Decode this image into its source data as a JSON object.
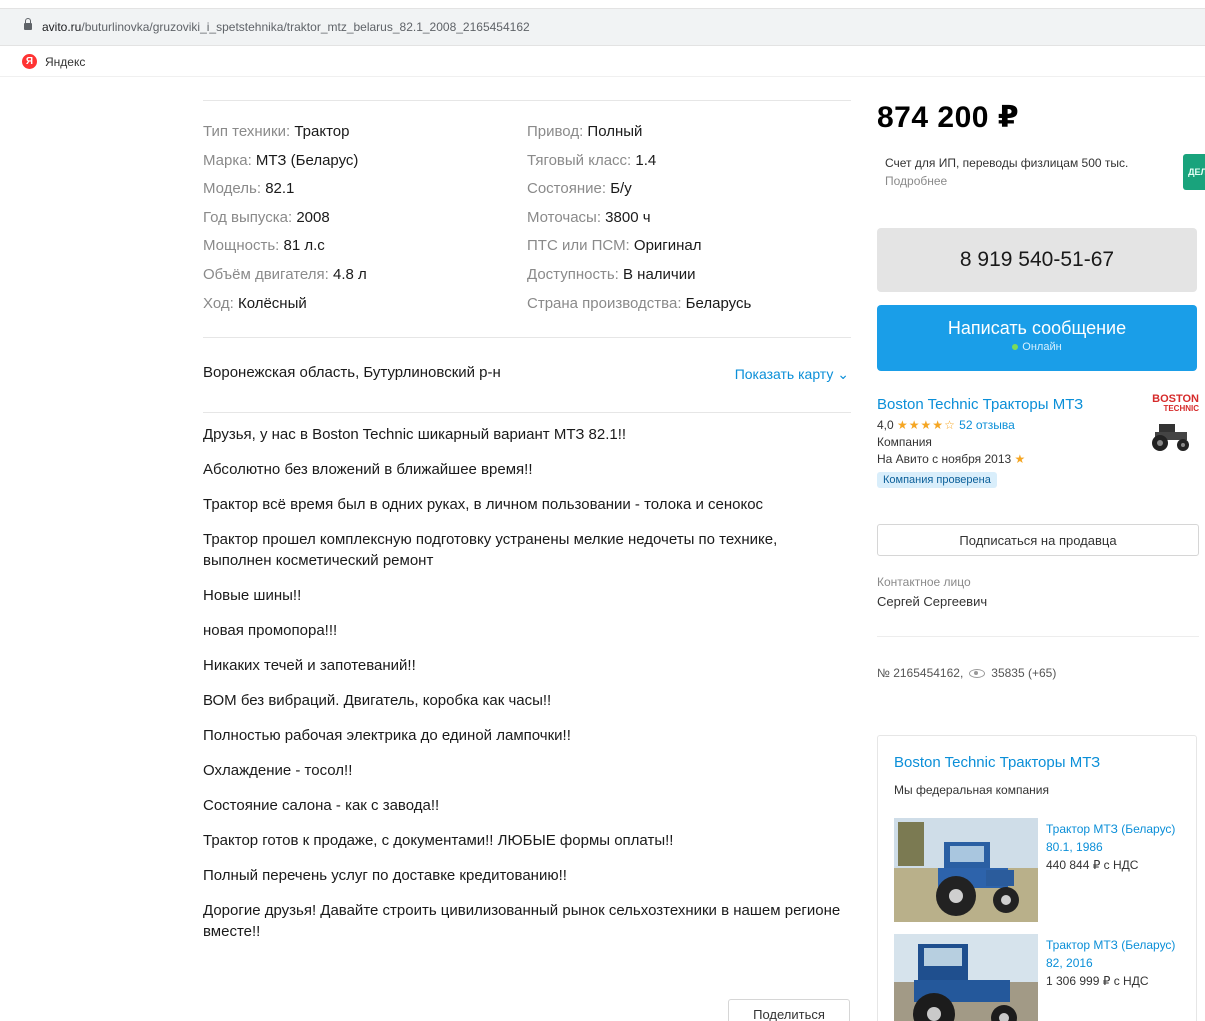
{
  "browser": {
    "url_domain": "avito.ru",
    "url_path": "/buturlinovka/gruzoviki_i_spetstehnika/traktor_mtz_belarus_82.1_2008_2165454162",
    "bookmark": "Яндекс"
  },
  "params": {
    "left": [
      {
        "label": "Тип техники:",
        "value": "Трактор"
      },
      {
        "label": "Марка:",
        "value": "МТЗ (Беларус)"
      },
      {
        "label": "Модель:",
        "value": "82.1"
      },
      {
        "label": "Год выпуска:",
        "value": "2008"
      },
      {
        "label": "Мощность:",
        "value": "81 л.с"
      },
      {
        "label": "Объём двигателя:",
        "value": "4.8 л"
      },
      {
        "label": "Ход:",
        "value": "Колёсный"
      }
    ],
    "right": [
      {
        "label": "Привод:",
        "value": "Полный"
      },
      {
        "label": "Тяговый класс:",
        "value": "1.4"
      },
      {
        "label": "Состояние:",
        "value": "Б/у"
      },
      {
        "label": "Моточасы:",
        "value": "3800 ч"
      },
      {
        "label": "ПТС или ПСМ:",
        "value": "Оригинал"
      },
      {
        "label": "Доступность:",
        "value": "В наличии"
      },
      {
        "label": "Страна производства:",
        "value": "Беларусь"
      }
    ]
  },
  "location": {
    "address": "Воронежская область, Бутурлиновский р-н",
    "map_link": "Показать карту"
  },
  "description": [
    "Друзья, у нас в Boston Technic шикарный вариант МТЗ 82.1!!",
    "Абсолютно без вложений в ближайшее время!!",
    "Трактор всё время был в одних руках, в личном пользовании - толока и сенокос",
    "Трактор прошел комплексную подготовку устранены мелкие недочеты по технике, выполнен косметический ремонт",
    "Новые шины!!",
    "новая промопора!!!",
    "Никаких течей и запотеваний!!",
    "ВОМ без вибраций. Двигатель, коробка как часы!!",
    "Полностью рабочая электрика до единой лампочки!!",
    "Охлаждение - тосол!!",
    "Состояние салона - как с завода!!",
    "Трактор готов к продаже, с документами!! ЛЮБЫЕ формы оплаты!!",
    "Полный перечень услуг по доставке кредитованию!!",
    "Дорогие друзья! Давайте строить цивилизованный рынок сельхозтехники в нашем регионе вместе!!"
  ],
  "share_button": "Поделиться",
  "sidebar": {
    "price": "874 200 ₽",
    "credit_text": "Счет для ИП, переводы физлицам 500 тыс.",
    "credit_more": "Подробнее",
    "bank_icon_text": "ДЕЛО",
    "phone": "8 919 540-51-67",
    "message_button": "Написать сообщение",
    "message_status": "Онлайн",
    "seller": {
      "name": "Boston Technic Тракторы МТЗ",
      "rating_value": "4,0",
      "stars": "★★★★☆",
      "reviews": "52 отзыва",
      "type": "Компания",
      "since": "На Авито с ноября 2013",
      "badge": "Компания проверена",
      "logo_line1": "BOSTON",
      "logo_line2": "TECHNIC"
    },
    "subscribe_button": "Подписаться на продавца",
    "contact_label": "Контактное лицо",
    "contact_name": "Сергей Сергеевич",
    "ad_number": "№ 2165454162,",
    "views": "35835 (+65)",
    "ad_block": {
      "title": "Boston Technic Тракторы МТЗ",
      "subtitle": "Мы федеральная компания",
      "items": [
        {
          "title": "Трактор МТЗ (Беларус) 80.1, 1986",
          "price": "440 844 ₽ с НДС"
        },
        {
          "title": "Трактор МТЗ (Беларус) 82, 2016",
          "price": "1 306 999 ₽ с НДС"
        }
      ]
    }
  }
}
